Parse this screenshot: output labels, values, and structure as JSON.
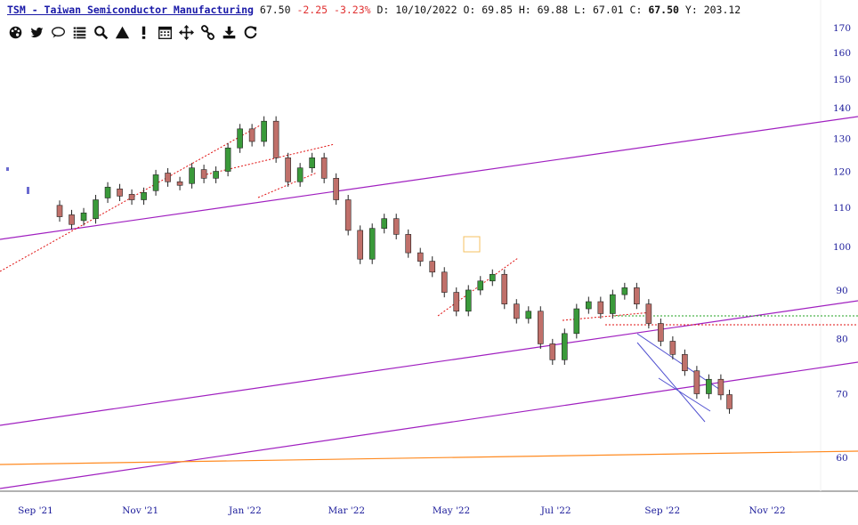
{
  "header": {
    "symbol_name": "TSM - Taiwan Semiconductor Manufacturing",
    "last": "67.50",
    "change": "-2.25",
    "change_pct": "-3.23%",
    "date_label": "D: 10/10/2022",
    "open_label": "O:",
    "open": "69.85",
    "high_label": "H:",
    "high": "69.88",
    "low_label": "L:",
    "low": "67.01",
    "close_label": "C:",
    "close": "67.50",
    "year_label": "Y:",
    "year_val": "203.12"
  },
  "toolbar": {
    "icons": [
      "palette-icon",
      "twitter-icon",
      "comment-icon",
      "list-icon",
      "search-icon",
      "warning-icon",
      "exclamation-icon",
      "calendar-icon",
      "move-icon",
      "link-icon",
      "download-icon",
      "refresh-icon"
    ]
  },
  "colors": {
    "up_candle": "#3a9a3a",
    "down_candle": "#c0706a",
    "channel": "#a020c0",
    "support": "#ff8a20",
    "dotted_red": "#e01010",
    "dotted_green": "#20a020",
    "blue_trend": "#5050d0"
  },
  "chart_data": {
    "type": "candlestick",
    "scale": "log",
    "ylim": [
      57,
      172
    ],
    "y_ticks": [
      60,
      70,
      80,
      90,
      100,
      110,
      120,
      130,
      140,
      150,
      160,
      170
    ],
    "x_ticks": [
      {
        "label": "Sep '21",
        "date": "2021-09-01"
      },
      {
        "label": "Nov '21",
        "date": "2021-11-01"
      },
      {
        "label": "Jan '22",
        "date": "2022-01-01"
      },
      {
        "label": "Mar '22",
        "date": "2022-03-01"
      },
      {
        "label": "May '22",
        "date": "2022-05-01"
      },
      {
        "label": "Jul '22",
        "date": "2022-07-01"
      },
      {
        "label": "Sep '22",
        "date": "2022-09-01"
      },
      {
        "label": "Nov '22",
        "date": "2022-11-01"
      }
    ],
    "series": [
      {
        "values": [
          [
            "2021-09-15",
            110.5,
            107.5
          ],
          [
            "2021-09-22",
            108.0,
            105.5
          ],
          [
            "2021-09-29",
            106.5,
            108.5
          ],
          [
            "2021-10-06",
            107.0,
            112.0
          ],
          [
            "2021-10-13",
            112.5,
            115.5
          ],
          [
            "2021-10-20",
            115.0,
            113.0
          ],
          [
            "2021-10-27",
            113.5,
            112.0
          ],
          [
            "2021-11-03",
            112.0,
            114.0
          ],
          [
            "2021-11-10",
            114.5,
            119.0
          ],
          [
            "2021-11-17",
            119.5,
            117.0
          ],
          [
            "2021-11-24",
            117.0,
            116.0
          ],
          [
            "2021-12-01",
            116.5,
            121.0
          ],
          [
            "2021-12-08",
            120.5,
            118.0
          ],
          [
            "2021-12-15",
            118.0,
            120.0
          ],
          [
            "2021-12-22",
            120.0,
            127.0
          ],
          [
            "2021-12-29",
            127.0,
            133.0
          ],
          [
            "2022-01-05",
            133.0,
            129.0
          ],
          [
            "2022-01-12",
            129.0,
            135.5
          ],
          [
            "2022-01-19",
            135.5,
            124.0
          ],
          [
            "2022-01-26",
            124.0,
            117.0
          ],
          [
            "2022-02-02",
            117.0,
            121.0
          ],
          [
            "2022-02-09",
            121.0,
            124.0
          ],
          [
            "2022-02-16",
            124.0,
            118.0
          ],
          [
            "2022-02-23",
            118.0,
            112.0
          ],
          [
            "2022-03-02",
            112.0,
            104.0
          ],
          [
            "2022-03-09",
            104.0,
            97.0
          ],
          [
            "2022-03-16",
            97.0,
            104.5
          ],
          [
            "2022-03-23",
            104.5,
            107.0
          ],
          [
            "2022-03-30",
            107.0,
            103.0
          ],
          [
            "2022-04-06",
            103.0,
            98.5
          ],
          [
            "2022-04-13",
            98.5,
            96.5
          ],
          [
            "2022-04-20",
            96.5,
            94.0
          ],
          [
            "2022-04-27",
            94.0,
            89.5
          ],
          [
            "2022-05-04",
            89.5,
            85.5
          ],
          [
            "2022-05-11",
            85.5,
            90.0
          ],
          [
            "2022-05-18",
            90.0,
            92.0
          ],
          [
            "2022-05-25",
            92.0,
            93.5
          ],
          [
            "2022-06-01",
            93.5,
            87.0
          ],
          [
            "2022-06-08",
            87.0,
            84.0
          ],
          [
            "2022-06-15",
            84.0,
            85.5
          ],
          [
            "2022-06-22",
            85.5,
            79.0
          ],
          [
            "2022-06-29",
            79.0,
            76.0
          ],
          [
            "2022-07-06",
            76.0,
            81.0
          ],
          [
            "2022-07-13",
            81.0,
            86.0
          ],
          [
            "2022-07-20",
            86.0,
            87.5
          ],
          [
            "2022-07-27",
            87.5,
            85.0
          ],
          [
            "2022-08-03",
            85.0,
            89.0
          ],
          [
            "2022-08-10",
            89.0,
            90.5
          ],
          [
            "2022-08-17",
            90.5,
            87.0
          ],
          [
            "2022-08-24",
            87.0,
            83.0
          ],
          [
            "2022-08-31",
            83.0,
            79.5
          ],
          [
            "2022-09-07",
            79.5,
            77.0
          ],
          [
            "2022-09-14",
            77.0,
            74.0
          ],
          [
            "2022-09-21",
            74.0,
            70.0
          ],
          [
            "2022-09-28",
            70.0,
            72.5
          ],
          [
            "2022-10-05",
            72.5,
            69.8
          ],
          [
            "2022-10-10",
            69.85,
            67.5
          ]
        ]
      }
    ]
  }
}
